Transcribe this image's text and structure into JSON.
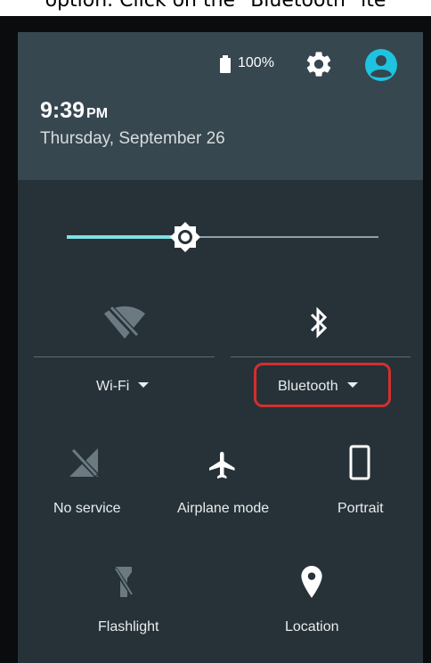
{
  "caption": "option. Click on the \"Bluetooth\" ite",
  "status": {
    "battery_text": "100%"
  },
  "header": {
    "time": "9:39",
    "ampm": "PM",
    "date": "Thursday, September 26"
  },
  "brightness": {
    "level": 0.38
  },
  "tiles": {
    "wifi": {
      "label": "Wi-Fi",
      "icon": "wifi-off-icon"
    },
    "bluetooth": {
      "label": "Bluetooth",
      "icon": "bluetooth-icon"
    },
    "no_service": {
      "label": "No service",
      "icon": "no-signal-icon"
    },
    "airplane": {
      "label": "Airplane mode",
      "icon": "airplane-icon"
    },
    "portrait": {
      "label": "Portrait",
      "icon": "phone-portrait-icon"
    },
    "flashlight": {
      "label": "Flashlight",
      "icon": "flashlight-icon"
    },
    "location": {
      "label": "Location",
      "icon": "location-pin-icon"
    }
  },
  "colors": {
    "accent": "#7fdfe4",
    "avatar": "#1ec3e0",
    "highlight": "#d32f2f",
    "panel": "#263238",
    "header": "#37474f"
  }
}
